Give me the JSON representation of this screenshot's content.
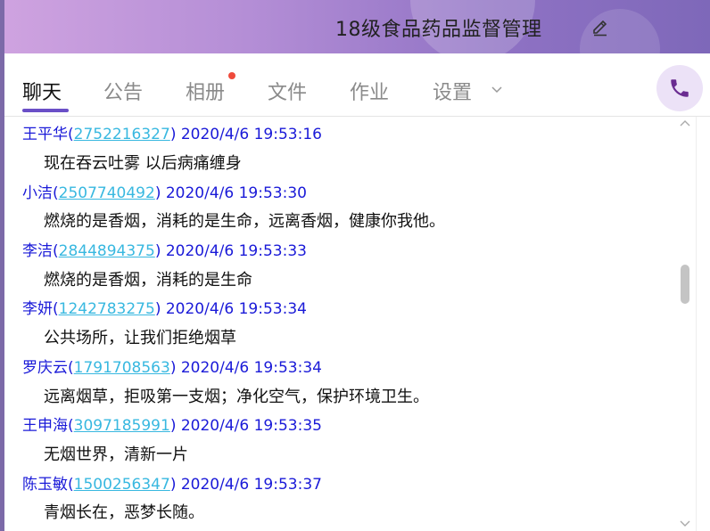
{
  "header": {
    "title": "18级食品药品监督管理",
    "edit_icon": "pencil-edit-icon"
  },
  "tabs": [
    {
      "label": "聊天",
      "active": true
    },
    {
      "label": "公告",
      "active": false
    },
    {
      "label": "相册",
      "active": false,
      "badge": "red-dot"
    },
    {
      "label": "文件",
      "active": false
    },
    {
      "label": "作业",
      "active": false
    },
    {
      "label": "设置",
      "active": false,
      "dropdown": true
    }
  ],
  "call_button": {
    "icon": "phone-icon"
  },
  "colors": {
    "accent": "#6a4fc7",
    "sender_name": "#1a1ad8",
    "qq_number": "#38b8e0",
    "badge": "#ef4a3b"
  },
  "messages": [
    {
      "name": "王平华",
      "qq": "2752216327",
      "time": "2020/4/6 19:53:16",
      "text": "现在吞云吐雾 以后病痛缠身"
    },
    {
      "name": "小洁",
      "qq": "2507740492",
      "time": "2020/4/6 19:53:30",
      "text": "燃烧的是香烟，消耗的是生命，远离香烟，健康你我他。"
    },
    {
      "name": "李洁",
      "qq": "2844894375",
      "time": "2020/4/6 19:53:33",
      "text": "燃烧的是香烟，消耗的是生命"
    },
    {
      "name": "李妍",
      "qq": "1242783275",
      "time": "2020/4/6 19:53:34",
      "text": "公共场所，让我们拒绝烟草"
    },
    {
      "name": "罗庆云",
      "qq": "1791708563",
      "time": "2020/4/6 19:53:34",
      "text": "远离烟草，拒吸第一支烟；净化空气，保护环境卫生。"
    },
    {
      "name": "王申海",
      "qq": "3097185991",
      "time": "2020/4/6 19:53:35",
      "text": "无烟世界，清新一片"
    },
    {
      "name": "陈玉敏",
      "qq": "1500256347",
      "time": "2020/4/6 19:53:37",
      "text": "青烟长在，恶梦长随。"
    }
  ]
}
